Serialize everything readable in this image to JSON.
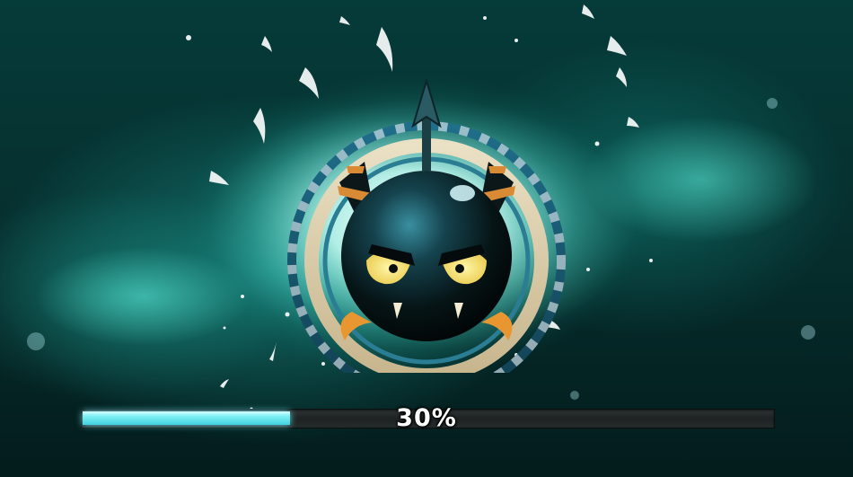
{
  "loading": {
    "progress_label": "30%",
    "progress_fraction": 0.3
  },
  "icons": {
    "mascot": "horned-black-bomb-creature-icon",
    "arrow": "arrow-up-icon"
  },
  "colors": {
    "background": "#06302f",
    "glow": "#8cfff0",
    "progress_fill": "#7ff0f4",
    "progress_track": "#262b2b"
  }
}
